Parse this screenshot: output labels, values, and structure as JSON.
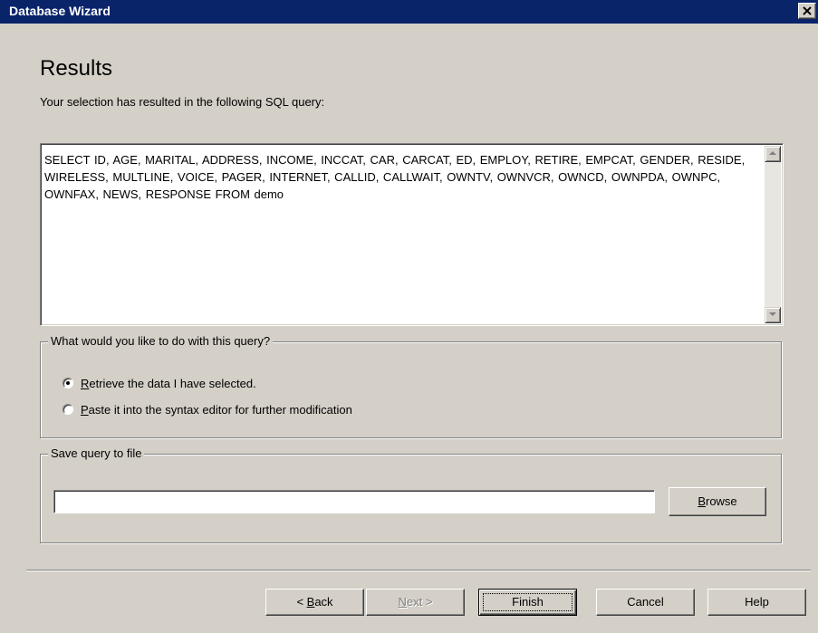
{
  "window": {
    "title": "Database Wizard"
  },
  "page": {
    "title": "Results",
    "subtitle": "Your selection has resulted in the following SQL query:"
  },
  "query": {
    "sql": "SELECT ID, AGE, MARITAL, ADDRESS, INCOME, INCCAT, CAR, CARCAT, ED, EMPLOY, RETIRE, EMPCAT, GENDER, RESIDE, WIRELESS, MULTLINE, VOICE, PAGER, INTERNET, CALLID, CALLWAIT, OWNTV, OWNVCR, OWNCD, OWNPDA, OWNPC, OWNFAX, NEWS, RESPONSE FROM demo"
  },
  "action_group": {
    "legend": "What would you like to do with this query?",
    "options": [
      {
        "mnemonic": "R",
        "rest": "etrieve the data I have selected.",
        "selected": true
      },
      {
        "mnemonic": "P",
        "rest": "aste it into the syntax editor for further modification",
        "selected": false
      }
    ]
  },
  "save_group": {
    "legend": "Save query to file",
    "file_value": "",
    "browse_mnemonic": "B",
    "browse_rest": "rowse"
  },
  "buttons": {
    "back_prefix": "< ",
    "back_mnemonic": "B",
    "back_rest": "ack",
    "next_mnemonic": "N",
    "next_rest": "ext >",
    "finish": "Finish",
    "cancel": "Cancel",
    "help": "Help"
  },
  "colors": {
    "titlebar": "#0a246a",
    "face": "#d4d0c8"
  }
}
